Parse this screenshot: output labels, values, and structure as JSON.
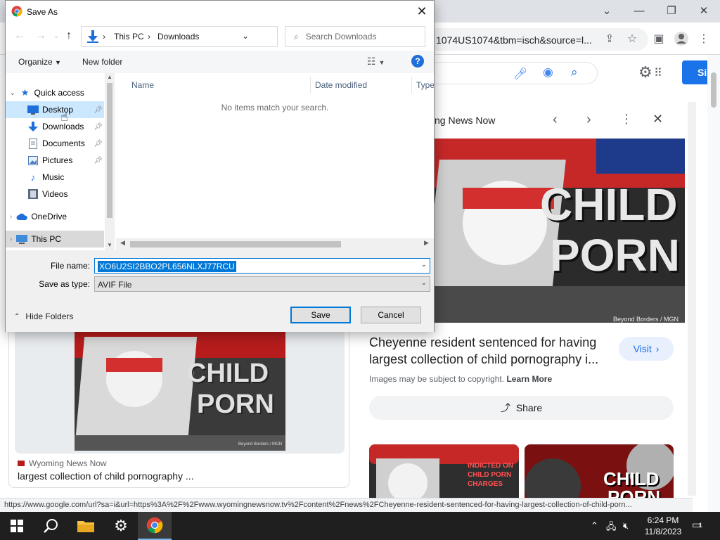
{
  "browser": {
    "url_partial": "1074US1074&tbm=isch&source=l...",
    "signin_label": "Si",
    "preview": {
      "source": "ng News Now",
      "image_caption": "Beyond Borders / MGN",
      "image_text_1": "CHILD",
      "image_text_2": "PORN",
      "title": "Cheyenne resident sentenced for having largest collection of child pornography i...",
      "visit_label": "Visit",
      "copyright_text": "Images may be subject to copyright.",
      "learn_more": "Learn More",
      "share_label": "Share",
      "related1_text": "INDICTED ON CHILD PORN CHARGES",
      "related2_text_1": "CHILD",
      "related2_text_2": "PORN"
    },
    "result": {
      "source": "Wyoming News Now",
      "title": "largest collection of child pornography ...",
      "image_text_1": "CHILD",
      "image_text_2": "PORN",
      "image_caption": "Beyond Borders / MGN"
    },
    "status_url": "https://www.google.com/url?sa=i&url=https%3A%2F%2Fwww.wyomingnewsnow.tv%2Fcontent%2Fnews%2FCheyenne-resident-sentenced-for-having-largest-collection-of-child-porn..."
  },
  "dialog": {
    "title": "Save As",
    "breadcrumb": [
      "This PC",
      "Downloads"
    ],
    "search_placeholder": "Search Downloads",
    "organize_label": "Organize",
    "new_folder_label": "New folder",
    "nav_items": [
      {
        "label": "Quick access",
        "icon": "star-icon"
      },
      {
        "label": "Desktop",
        "icon": "desktop-icon"
      },
      {
        "label": "Downloads",
        "icon": "download-icon"
      },
      {
        "label": "Documents",
        "icon": "document-icon"
      },
      {
        "label": "Pictures",
        "icon": "pictures-icon"
      },
      {
        "label": "Music",
        "icon": "music-icon"
      },
      {
        "label": "Videos",
        "icon": "video-icon"
      },
      {
        "label": "OneDrive",
        "icon": "cloud-icon"
      },
      {
        "label": "This PC",
        "icon": "computer-icon"
      }
    ],
    "columns": [
      "Name",
      "Date modified",
      "Type"
    ],
    "empty_message": "No items match your search.",
    "file_name_label": "File name:",
    "file_name_value": "XO6U2SI2BBO2PL656NLXJ77RCU",
    "save_type_label": "Save as type:",
    "save_type_value": "AVIF File",
    "hide_folders_label": "Hide Folders",
    "save_label": "Save",
    "cancel_label": "Cancel"
  },
  "taskbar": {
    "time": "6:24 PM",
    "date": "11/8/2023",
    "notification_count": "1"
  },
  "colors": {
    "accent": "#0078d7",
    "google_blue": "#1a73e8",
    "taskbar": "#1f1f1f"
  }
}
